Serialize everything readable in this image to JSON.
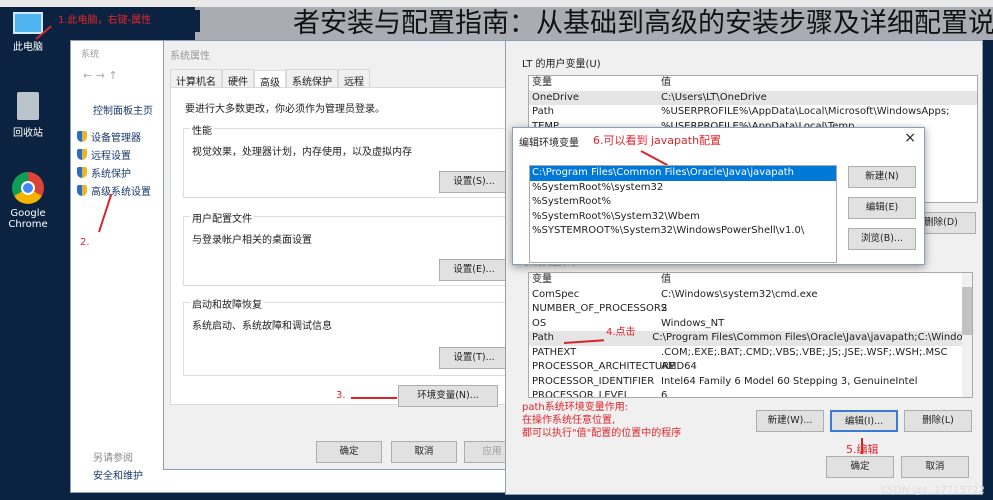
{
  "banner": {
    "title": "者安装与配置指南：从基础到高级的安装步骤及详细配置说明"
  },
  "desktop": {
    "icons": [
      {
        "label": "此电脑",
        "icon": "computer-icon"
      },
      {
        "label": "回收站",
        "icon": "recycle-bin-icon"
      },
      {
        "label": "Google Chrome",
        "icon": "chrome-icon"
      }
    ]
  },
  "annotations": {
    "step1": "1.此电脑，右键-属性",
    "step2": "2.",
    "step3": "3.",
    "step4": "4.点击",
    "step5": "5.编辑",
    "step6": "6.可以看到 javapath配置",
    "note": [
      "path系统环境变量作用:",
      "在操作系统任意位置,",
      "都可以执行\"值\"配置的位置中的程序"
    ],
    "color": "#e0262b"
  },
  "system_window": {
    "title": "系统",
    "home": "控制面板主页",
    "nav": [
      "设备管理器",
      "远程设置",
      "系统保护",
      "高级系统设置"
    ],
    "see_also": "另请参阅",
    "security": "安全和维护"
  },
  "sysprops": {
    "title": "系统属性",
    "tabs": [
      "计算机名",
      "硬件",
      "高级",
      "系统保护",
      "远程"
    ],
    "active_tab": "高级",
    "admin_note": "要进行大多数更改，你必须作为管理员登录。",
    "groups": [
      {
        "label": "性能",
        "desc": "视觉效果，处理器计划，内存使用，以及虚拟内存",
        "button": "设置(S)..."
      },
      {
        "label": "用户配置文件",
        "desc": "与登录帐户相关的桌面设置",
        "button": "设置(E)..."
      },
      {
        "label": "启动和故障恢复",
        "desc": "系统启动、系统故障和调试信息",
        "button": "设置(T)..."
      }
    ],
    "env_button": "环境变量(N)...",
    "ok": "确定",
    "cancel": "取消",
    "apply": "应用"
  },
  "envvars": {
    "user_label": "LT 的用户变量(U)",
    "headers": [
      "变量",
      "值"
    ],
    "user_rows": [
      [
        "OneDrive",
        "C:\\Users\\LT\\OneDrive"
      ],
      [
        "Path",
        "%USERPROFILE%\\AppData\\Local\\Microsoft\\WindowsApps;"
      ],
      [
        "TEMP",
        "%USERPROFILE%\\AppData\\Local\\Temp"
      ]
    ],
    "user_delete": "删除(D)",
    "system_label": "系统变量(S)",
    "system_rows": [
      [
        "ComSpec",
        "C:\\Windows\\system32\\cmd.exe"
      ],
      [
        "NUMBER_OF_PROCESSORS",
        "2"
      ],
      [
        "OS",
        "Windows_NT"
      ],
      [
        "Path",
        "C:\\Program Files\\Common Files\\Oracle\\Java\\javapath;C:\\Windo..."
      ],
      [
        "PATHEXT",
        ".COM;.EXE;.BAT;.CMD;.VBS;.VBE;.JS;.JSE;.WSF;.WSH;.MSC"
      ],
      [
        "PROCESSOR_ARCHITECTURE",
        "AMD64"
      ],
      [
        "PROCESSOR_IDENTIFIER",
        "Intel64 Family 6 Model 60 Stepping 3, GenuineIntel"
      ],
      [
        "PROCESSOR_LEVEL",
        "6"
      ]
    ],
    "selected_system_row": "Path",
    "new": "新建(W)...",
    "edit": "编辑(I)...",
    "delete": "删除(L)",
    "ok": "确定",
    "cancel": "取消"
  },
  "editenv": {
    "title": "编辑环境变量",
    "entries": [
      "C:\\Program Files\\Common Files\\Oracle\\Java\\javapath",
      "%SystemRoot%\\system32",
      "%SystemRoot%",
      "%SystemRoot%\\System32\\Wbem",
      "%SYSTEMROOT%\\System32\\WindowsPowerShell\\v1.0\\"
    ],
    "selected": 0,
    "new": "新建(N)",
    "edit": "编辑(E)",
    "browse": "浏览(B)...",
    "close": "×",
    "select_color": "#0078d7"
  },
  "watermark": "CSDN @z..17715722"
}
